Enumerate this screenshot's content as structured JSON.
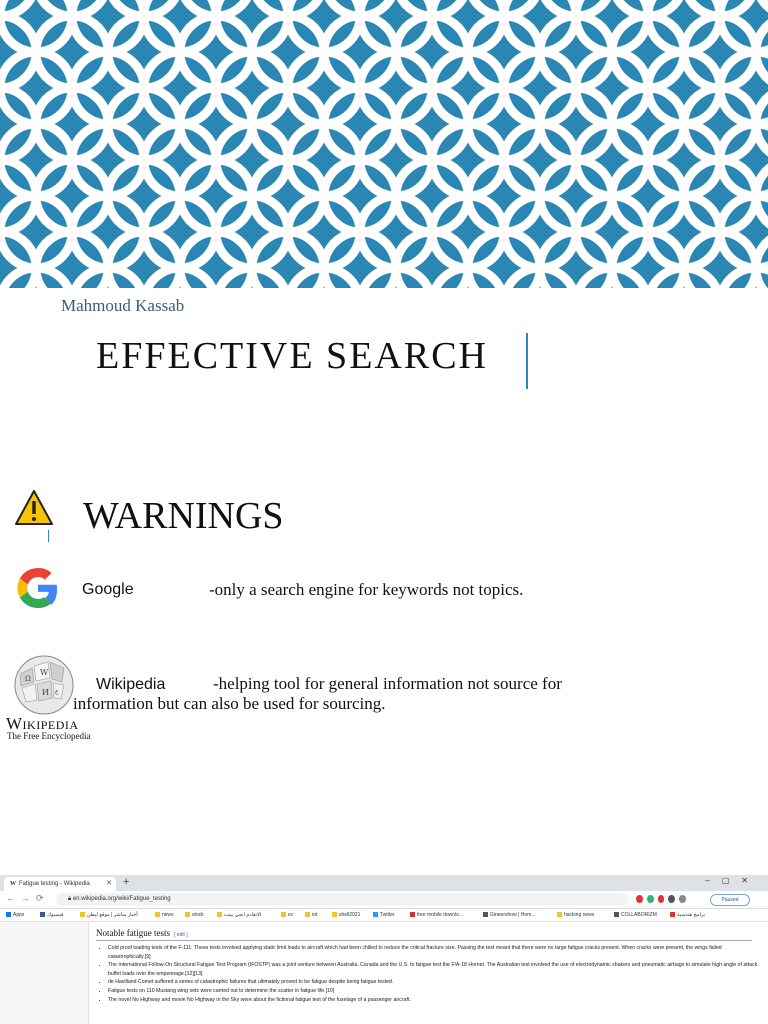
{
  "author": "Mahmoud Kassab",
  "title": "EFFECTIVE SEARCH",
  "warnings": "WARNINGS",
  "google": {
    "label": "Google",
    "description": "-only a search engine for keywords not topics."
  },
  "wikipedia": {
    "label": "Wikipedia",
    "description_line1": "-helping tool for general information not source for",
    "description_line2": "information but can also be used for sourcing.",
    "logo_word": "Wikipedia",
    "logo_tagline": "The Free Encyclopedia"
  },
  "colors": {
    "banner_blue": "#2a86b3",
    "accent_blue": "#2e8ab8",
    "author_text": "#3b5b7a"
  },
  "browser": {
    "tab_title": "Fatigue testing - Wikipedia",
    "url": "en.wikipedia.org/wiki/Fatigue_testing",
    "paused_label": "Paused",
    "bookmarks": [
      "Apps",
      "فيسبوك",
      "أخبار مباشر | موقع لبطن",
      "news",
      "stock",
      "الاتقادم ابجي بيتت",
      "ec",
      "iot",
      "shell2021",
      "Twitter",
      "free mobile downlo...",
      "Gineershow | Hom...",
      "hacking news",
      "COLLABORIZM",
      "برامج هندسية"
    ],
    "section_heading": "Notable fatigue tests",
    "edit_label": "[ edit ]",
    "items": [
      "Cold proof loading tests of the F-111: These tests involved applying static limit loads to aircraft which had been chilled to reduce the critical fracture size. Passing the test meant that there were no large fatigue cracks present. When cracks were present, the wings failed catastrophically.[9]",
      "The International Follow-On Structural Fatigue Test Program (IFOSTP) was a joint venture between Australia, Canada and the U.S. to fatigue test the F/A-18 Hornet. The Australian test involved the use of electrodynamic shakers and pneumatic airbags to simulate high angle of attack buffet loads over the empennage.[12][13]",
      "de Havilland Comet suffered a series of catastrophic failures that ultimately proved to be fatigue despite being fatigue tested.",
      "Fatigue tests on 110 Mustang wing sets were carried out to determine the scatter in fatigue life.[10]",
      "The novel No Highway and movie No Highway in the Sky were about the fictional fatigue test of the fuselage of a passenger aircraft."
    ]
  }
}
